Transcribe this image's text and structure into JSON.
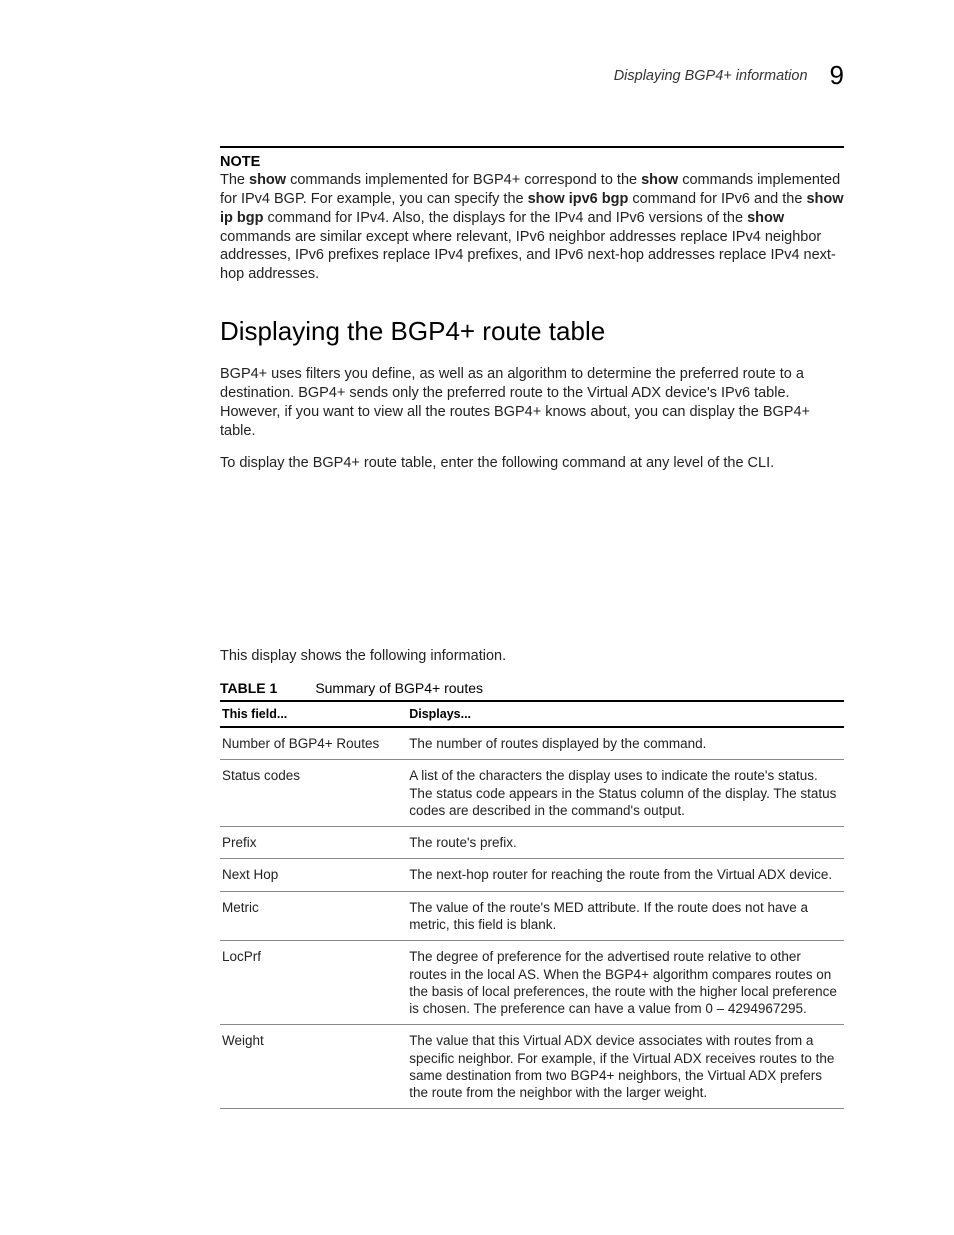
{
  "header": {
    "running_title": "Displaying BGP4+ information",
    "chapter_number": "9"
  },
  "note": {
    "label": "NOTE",
    "text_1a": "The ",
    "text_1b": "show",
    "text_1c": " commands implemented for BGP4+ correspond to the ",
    "text_1d": "show",
    "text_1e": " commands implemented for IPv4 BGP. For example, you can specify the ",
    "text_1f": "show ipv6 bgp",
    "text_1g": " command for IPv6 and the ",
    "text_1h": "show ip bgp",
    "text_1i": " command for IPv4. Also, the displays for the IPv4 and IPv6 versions of the ",
    "text_1j": "show",
    "text_1k": " commands are similar except where relevant, IPv6 neighbor addresses replace IPv4 neighbor addresses, IPv6 prefixes replace IPv4 prefixes, and IPv6 next-hop addresses replace IPv4 next-hop addresses."
  },
  "section": {
    "heading": "Displaying the BGP4+ route table",
    "para1": "BGP4+ uses filters you define, as well as an algorithm to determine the preferred route to a destination. BGP4+ sends only the preferred route to the Virtual ADX device's IPv6 table. However, if you want to view all the routes BGP4+ knows about, you can display the BGP4+ table.",
    "para2": "To display the BGP4+ route table, enter the following command at any level of the CLI.",
    "para3": "This display shows the following information."
  },
  "table": {
    "label": "TABLE 1",
    "caption": "Summary of BGP4+ routes",
    "head_field": "This field...",
    "head_displays": "Displays...",
    "rows": [
      {
        "field": "Number of BGP4+ Routes",
        "displays": "The number of routes displayed by the command."
      },
      {
        "field": "Status codes",
        "displays": "A list of the characters the display uses to indicate the route's status. The status code appears in the Status column of the display. The status codes are described in the command's output."
      },
      {
        "field": "Prefix",
        "displays": "The route's prefix."
      },
      {
        "field": "Next Hop",
        "displays": "The next-hop router for reaching the route from the Virtual ADX device."
      },
      {
        "field": "Metric",
        "displays": "The value of the route's MED attribute. If the route does not have a metric, this field is blank."
      },
      {
        "field": "LocPrf",
        "displays": "The degree of preference for the advertised route relative to other routes in the local AS. When the BGP4+ algorithm compares routes on the basis of local preferences, the route with the higher local preference is chosen. The preference can have a value from 0 – 4294967295."
      },
      {
        "field": "Weight",
        "displays": "The value that this Virtual ADX device associates with routes from a specific neighbor. For example, if the Virtual ADX receives routes to the same destination from two BGP4+ neighbors, the Virtual ADX prefers the route from the neighbor with the larger weight."
      }
    ]
  }
}
